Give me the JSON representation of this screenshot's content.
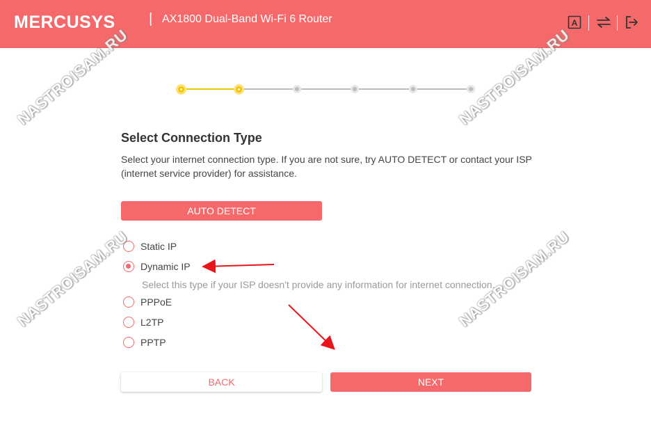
{
  "header": {
    "brand": "MERCUSYS",
    "separator": "|",
    "model": "AX1800 Dual-Band Wi-Fi 6 Router",
    "icons": [
      "language-icon",
      "transfer-icon",
      "logout-icon"
    ]
  },
  "stepper": {
    "total_steps": 6,
    "completed_steps": 2,
    "active_color": "#f9c400",
    "inactive_color": "#bdbdbd"
  },
  "main": {
    "title": "Select Connection Type",
    "description": "Select your internet connection type. If you are not sure, try AUTO DETECT or contact your ISP (internet service provider) for assistance.",
    "auto_detect_label": "AUTO DETECT",
    "options": [
      {
        "label": "Static IP",
        "checked": false
      },
      {
        "label": "Dynamic IP",
        "checked": true
      },
      {
        "label": "PPPoE",
        "checked": false
      },
      {
        "label": "L2TP",
        "checked": false
      },
      {
        "label": "PPTP",
        "checked": false
      }
    ],
    "dynamic_hint": "Select this type if your ISP doesn't provide any information for internet connection.",
    "back_label": "BACK",
    "next_label": "NEXT"
  },
  "watermark": "NASTROISAM.RU",
  "colors": {
    "brand": "#f6696a",
    "annotation_arrow": "#e8161b"
  }
}
